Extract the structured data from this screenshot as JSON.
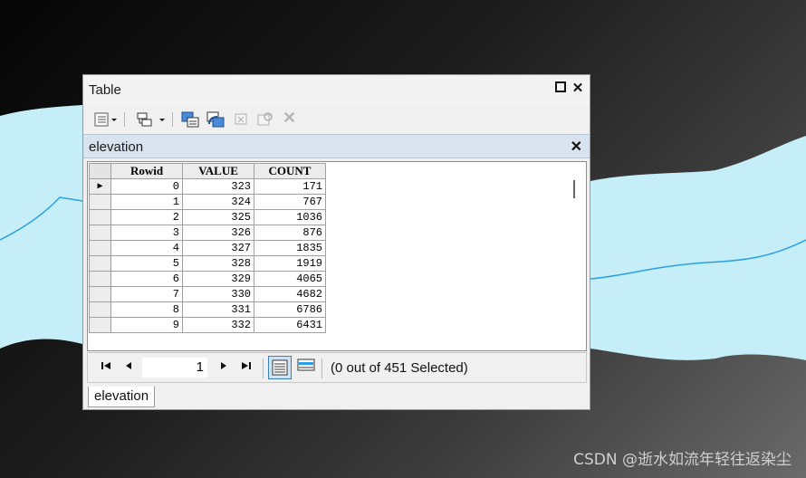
{
  "window": {
    "title": "Table"
  },
  "toolbar": {
    "icons": [
      "table-options-icon",
      "related-tables-icon",
      "select-by-attributes-icon",
      "switch-selection-icon",
      "clear-selection-icon",
      "zoom-to-selected-icon",
      "delete-selected-icon"
    ]
  },
  "table_tab": {
    "name": "elevation"
  },
  "grid": {
    "columns": [
      "Rowid",
      "VALUE",
      "COUNT"
    ],
    "rows": [
      [
        "0",
        "323",
        "171"
      ],
      [
        "1",
        "324",
        "767"
      ],
      [
        "2",
        "325",
        "1036"
      ],
      [
        "3",
        "326",
        "876"
      ],
      [
        "4",
        "327",
        "1835"
      ],
      [
        "5",
        "328",
        "1919"
      ],
      [
        "6",
        "329",
        "4065"
      ],
      [
        "7",
        "330",
        "4682"
      ],
      [
        "8",
        "331",
        "6786"
      ],
      [
        "9",
        "332",
        "6431"
      ]
    ]
  },
  "navigation": {
    "current_record": "1",
    "selection_info": "(0 out of 451 Selected)"
  },
  "bottom_tab": {
    "label": "elevation"
  },
  "watermark": "CSDN @逝水如流年轻往返染尘",
  "colors": {
    "river": "#c6eef8",
    "river_line": "#2a9fe8",
    "tab_header": "#d9e3ef"
  }
}
